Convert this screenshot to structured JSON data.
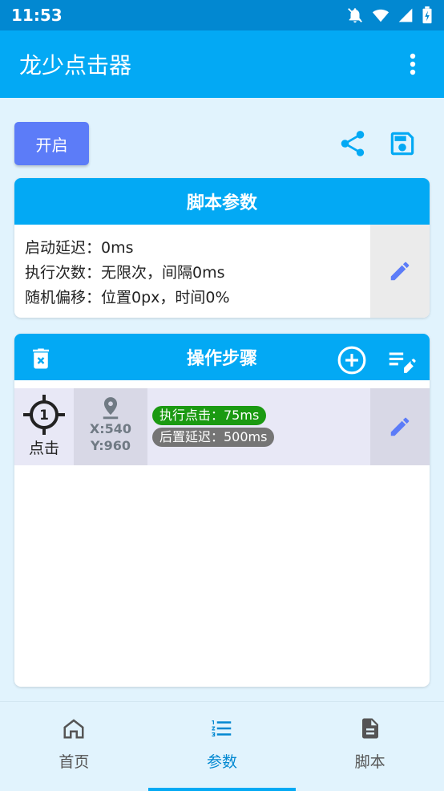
{
  "status": {
    "time": "11:53"
  },
  "app": {
    "title": "龙少点击器"
  },
  "toolbar": {
    "start_label": "开启"
  },
  "params": {
    "header": "脚本参数",
    "lines": [
      "启动延迟：0ms",
      "执行次数：无限次，间隔0ms",
      "随机偏移：位置0px，时间0%"
    ]
  },
  "steps": {
    "header": "操作步骤",
    "items": [
      {
        "number": "1",
        "type": "点击",
        "x": "X:540",
        "y": "Y:960",
        "exec": "执行点击：75ms",
        "delay": "后置延迟：500ms"
      }
    ]
  },
  "nav": {
    "items": [
      {
        "label": "首页",
        "icon": "home-icon"
      },
      {
        "label": "参数",
        "icon": "list-numbered-icon"
      },
      {
        "label": "脚本",
        "icon": "document-icon"
      }
    ],
    "active": 1
  },
  "colors": {
    "primary": "#03a9f4",
    "primary_dark": "#0288d1",
    "button": "#5c7cf8",
    "green_badge": "#1b9a12",
    "grey_badge": "#757575"
  }
}
